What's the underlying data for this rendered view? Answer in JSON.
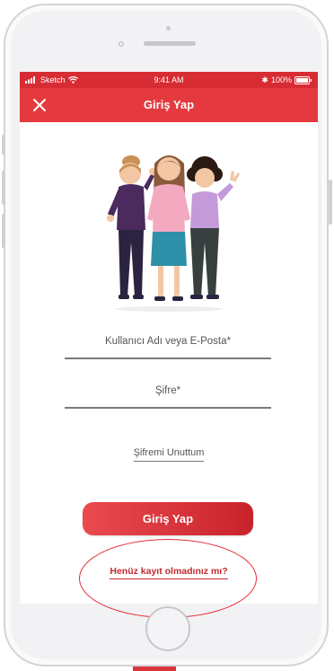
{
  "status_bar": {
    "carrier": "Sketch",
    "time": "9:41 AM",
    "battery": "100%"
  },
  "nav": {
    "title": "Giriş Yap",
    "close_icon": "close-icon"
  },
  "form": {
    "username_label": "Kullanıcı Adı veya E-Posta*",
    "password_label": "Şifre*",
    "forgot_password": "Şifremi Unuttum",
    "login_button": "Giriş Yap",
    "register_link": "Henüz kayıt olmadınız mı?"
  },
  "colors": {
    "brand_red": "#e43a3f",
    "status_red": "#d72c33",
    "annotation_red": "#e52d35"
  }
}
